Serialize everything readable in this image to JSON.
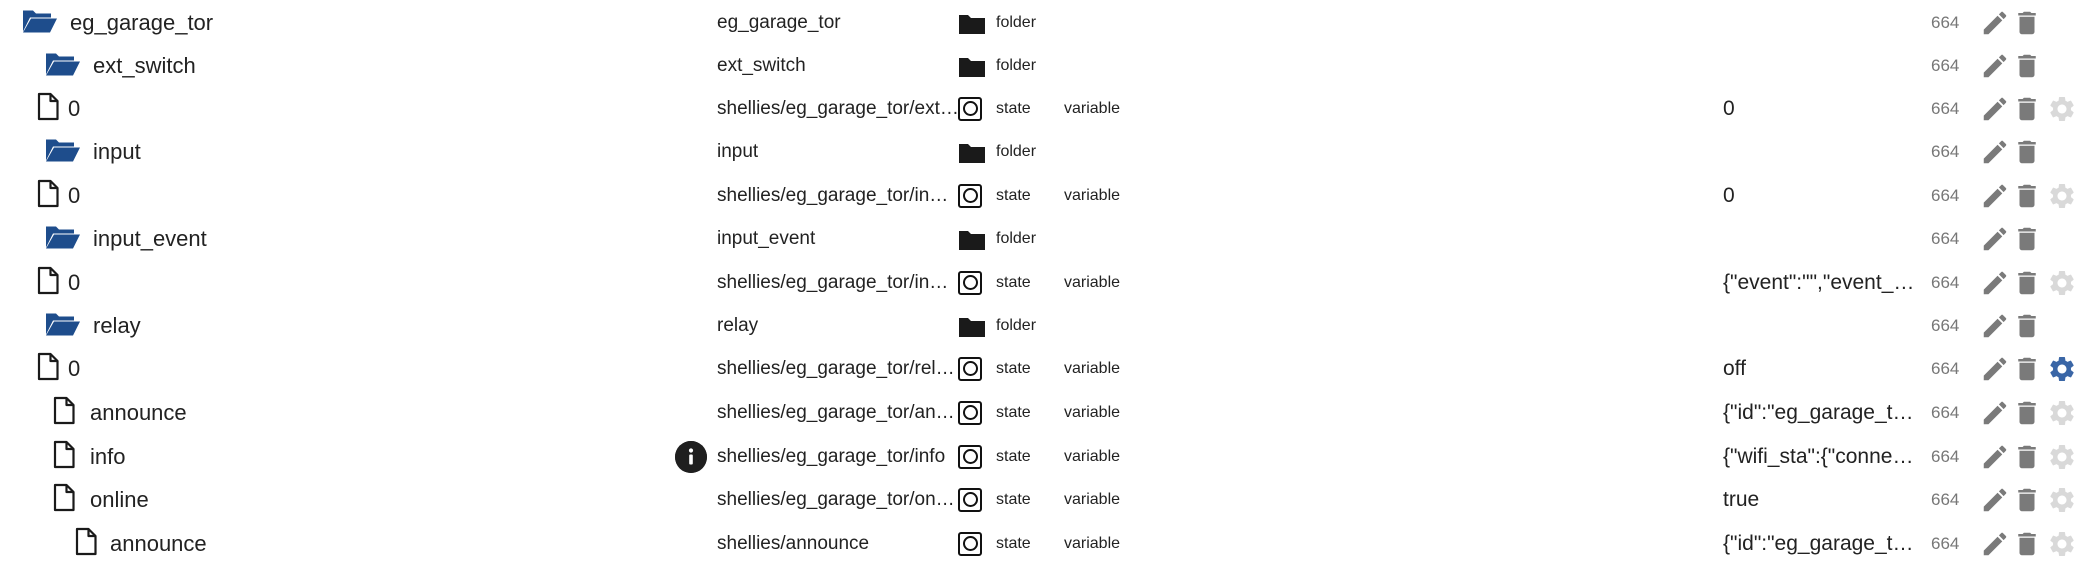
{
  "rows": [
    {
      "kind": "folder",
      "depth": 0,
      "name": "eg_garage_tor",
      "id": "eg_garage_tor",
      "type": "folder",
      "role": "",
      "value": "",
      "acl": "664",
      "gear": "none",
      "info": false
    },
    {
      "kind": "folder",
      "depth": 1,
      "name": "ext_switch",
      "id": "ext_switch",
      "type": "folder",
      "role": "",
      "value": "",
      "acl": "664",
      "gear": "none",
      "info": false
    },
    {
      "kind": "file",
      "depth": 2,
      "name": "0",
      "id": "shellies/eg_garage_tor/ext…",
      "type": "state",
      "role": "variable",
      "value": "0",
      "acl": "664",
      "gear": "light",
      "info": false
    },
    {
      "kind": "folder",
      "depth": 1,
      "name": "input",
      "id": "input",
      "type": "folder",
      "role": "",
      "value": "",
      "acl": "664",
      "gear": "none",
      "info": false
    },
    {
      "kind": "file",
      "depth": 2,
      "name": "0",
      "id": "shellies/eg_garage_tor/in…",
      "type": "state",
      "role": "variable",
      "value": "0",
      "acl": "664",
      "gear": "light",
      "info": false
    },
    {
      "kind": "folder",
      "depth": 1,
      "name": "input_event",
      "id": "input_event",
      "type": "folder",
      "role": "",
      "value": "",
      "acl": "664",
      "gear": "none",
      "info": false
    },
    {
      "kind": "file",
      "depth": 2,
      "name": "0",
      "id": "shellies/eg_garage_tor/in…",
      "type": "state",
      "role": "variable",
      "value": "{\"event\":\"\",\"event_…",
      "acl": "664",
      "gear": "light",
      "info": false
    },
    {
      "kind": "folder",
      "depth": 1,
      "name": "relay",
      "id": "relay",
      "type": "folder",
      "role": "",
      "value": "",
      "acl": "664",
      "gear": "none",
      "info": false
    },
    {
      "kind": "file",
      "depth": 2,
      "name": "0",
      "id": "shellies/eg_garage_tor/rel…",
      "type": "state",
      "role": "variable",
      "value": "off",
      "acl": "664",
      "gear": "active",
      "info": false
    },
    {
      "kind": "file",
      "depth": 1,
      "name": "announce",
      "id": "shellies/eg_garage_tor/an…",
      "type": "state",
      "role": "variable",
      "value": "{\"id\":\"eg_garage_t…",
      "acl": "664",
      "gear": "light",
      "info": false
    },
    {
      "kind": "file",
      "depth": 1,
      "name": "info",
      "id": "shellies/eg_garage_tor/info",
      "type": "state",
      "role": "variable",
      "value": "{\"wifi_sta\":{\"conne…",
      "acl": "664",
      "gear": "light",
      "info": true
    },
    {
      "kind": "file",
      "depth": 1,
      "name": "online",
      "id": "shellies/eg_garage_tor/on…",
      "type": "state",
      "role": "variable",
      "value": "true",
      "acl": "664",
      "gear": "light",
      "info": false
    },
    {
      "kind": "file",
      "depth": 0,
      "name": "announce",
      "id": "shellies/announce",
      "type": "state",
      "role": "variable",
      "value": "{\"id\":\"eg_garage_t…",
      "acl": "664",
      "gear": "light",
      "info": false
    }
  ],
  "colors": {
    "folder_icon": "#1e4d8c",
    "action_icon": "#7a7a7a",
    "gear_active": "#3a66a6",
    "gear_inactive": "#d9d9d9"
  },
  "icons": {
    "folder_open": "folder-open-icon",
    "file": "file-icon",
    "folder_type": "folder-type-icon",
    "state_type": "state-type-icon",
    "edit": "edit-icon",
    "delete": "delete-icon",
    "gear": "gear-icon",
    "info": "info-icon"
  }
}
